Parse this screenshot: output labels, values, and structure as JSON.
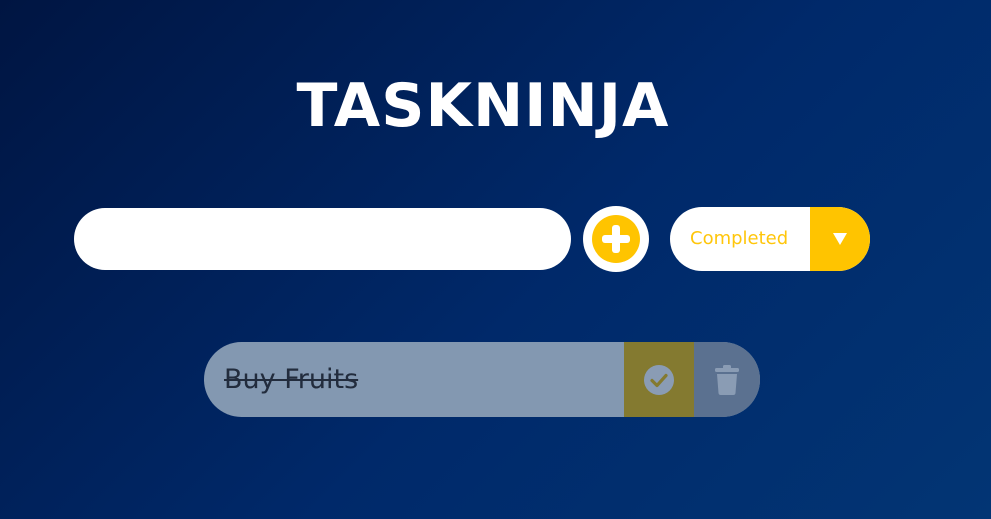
{
  "header": {
    "title": "TASKNINJA"
  },
  "form": {
    "task_input_value": "",
    "add_icon": "plus-circle-icon",
    "filter": {
      "selected": "Completed",
      "arrow_icon": "triangle-down-icon"
    }
  },
  "todos": [
    {
      "text": "Buy Fruits",
      "completed": true,
      "complete_icon": "check-circle-icon",
      "delete_icon": "trash-icon"
    }
  ],
  "colors": {
    "accent": "#ffc400",
    "background_start": "#001542",
    "background_end": "#023574",
    "todo_background": "#8398b1",
    "complete_button": "#847a30",
    "trash_button": "#5b7190"
  }
}
